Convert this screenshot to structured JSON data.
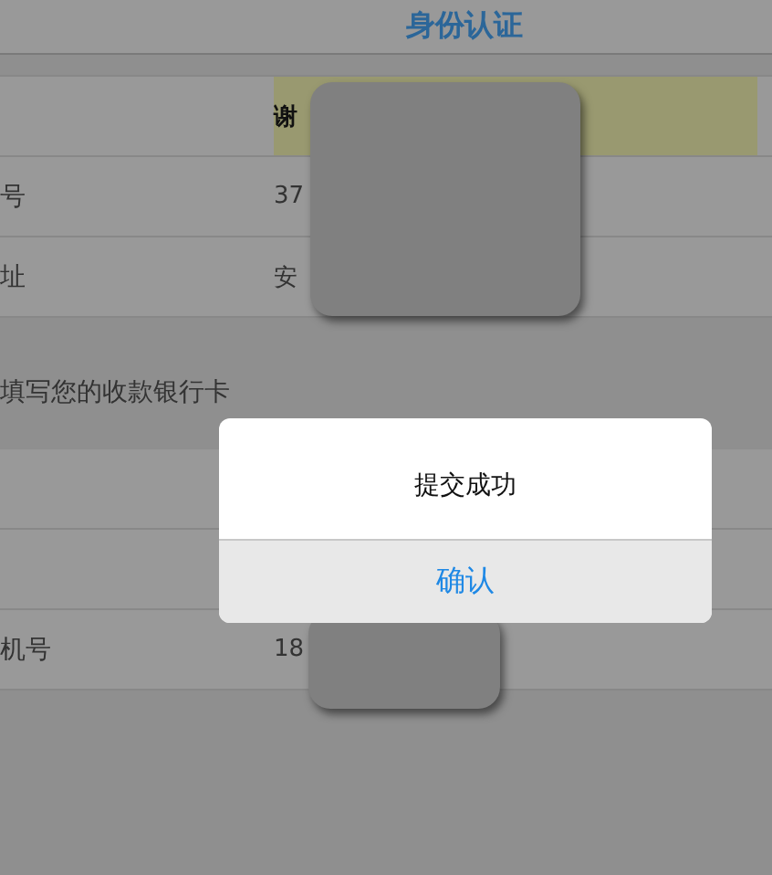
{
  "header": {
    "title": "身份认证"
  },
  "identity_rows": [
    {
      "label": "",
      "value": "谢",
      "highlighted": true
    },
    {
      "label": "号",
      "value": "37",
      "highlighted": false
    },
    {
      "label": "址",
      "value": "安",
      "highlighted": false
    }
  ],
  "bank_section": {
    "title": "填写您的收款银行卡"
  },
  "bank_rows": [
    {
      "label": "",
      "value": ""
    },
    {
      "label": "",
      "value": ""
    },
    {
      "label": "机号",
      "value": "18"
    }
  ],
  "dialog": {
    "message": "提交成功",
    "button": "确认"
  }
}
